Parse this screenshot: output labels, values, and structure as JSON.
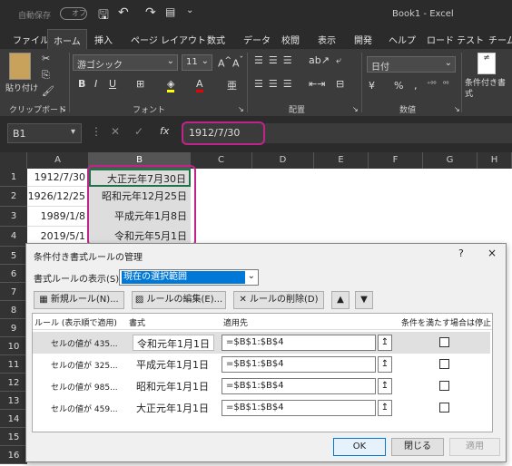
{
  "titlebar": {
    "autosave": "自動保存",
    "autosave_state": "オフ",
    "title": "Book1 - Excel"
  },
  "tabs": [
    "ファイル",
    "ホーム",
    "挿入",
    "ページ レイアウト",
    "数式",
    "データ",
    "校閲",
    "表示",
    "開発",
    "ヘルプ",
    "ロード テスト",
    "チーム"
  ],
  "ribbon": {
    "paste": "貼り付け",
    "clipboard": "クリップボード",
    "font_name": "游ゴシック",
    "font_size": "11",
    "font_group": "フォント",
    "align_group": "配置",
    "number_format": "日付",
    "number_group": "数値",
    "cond_format": "条件付き書式",
    "bold": "B",
    "italic": "I",
    "underline": "U",
    "currency": "¥",
    "percent": "%",
    "comma": ","
  },
  "formula_bar": {
    "name_box": "B1",
    "fx": "fx",
    "value": "1912/7/30"
  },
  "columns": [
    "A",
    "B",
    "C",
    "D",
    "E",
    "F",
    "G",
    "H"
  ],
  "rows": [
    "1",
    "2",
    "3",
    "4",
    "5",
    "6",
    "7",
    "8",
    "9",
    "10",
    "11",
    "12",
    "13",
    "14",
    "15",
    "16"
  ],
  "cells_a": [
    "1912/7/30",
    "1926/12/25",
    "1989/1/8",
    "2019/5/1"
  ],
  "cells_b": [
    "大正元年7月30日",
    "昭和元年12月25日",
    "平成元年1月8日",
    "令和元年5月1日"
  ],
  "dialog": {
    "title": "条件付き書式ルールの管理",
    "help": "?",
    "close": "×",
    "show_rules_label": "書式ルールの表示(S):",
    "show_rules_value": "現在の選択範囲",
    "new_rule": "新規ルール(N)...",
    "edit_rule": "ルールの編集(E)...",
    "delete_rule": "ルールの削除(D)",
    "col_rule": "ルール (表示順で適用)",
    "col_format": "書式",
    "col_applies": "適用先",
    "col_stop": "条件を満たす場合は停止",
    "rules": [
      {
        "rule": "セルの値が 435...",
        "format": "令和元年1月1日",
        "applies": "=$B$1:$B$4"
      },
      {
        "rule": "セルの値が 325...",
        "format": "平成元年1月1日",
        "applies": "=$B$1:$B$4"
      },
      {
        "rule": "セルの値が 985...",
        "format": "昭和元年1月1日",
        "applies": "=$B$1:$B$4"
      },
      {
        "rule": "セルの値が 459...",
        "format": "大正元年1月1日",
        "applies": "=$B$1:$B$4"
      }
    ],
    "ok": "OK",
    "close_btn": "閉じる",
    "apply": "適用"
  }
}
